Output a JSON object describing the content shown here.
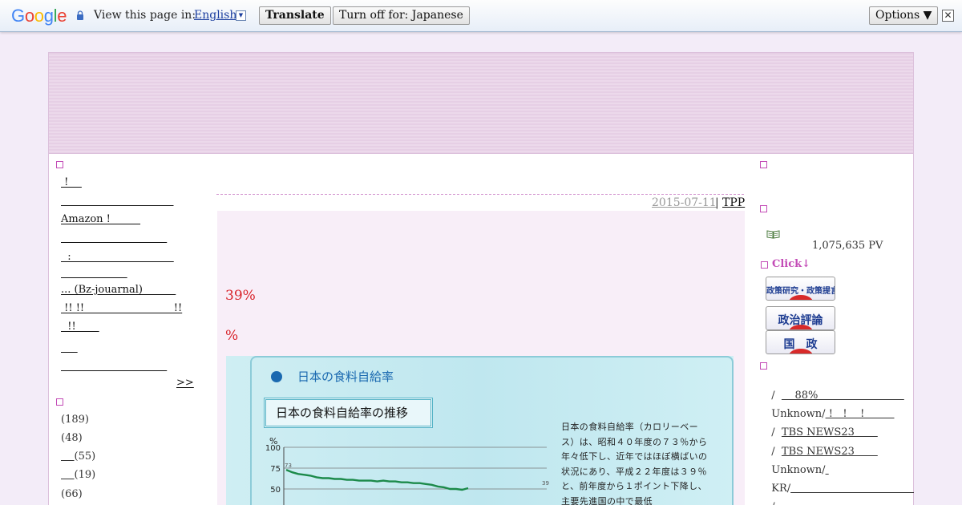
{
  "translate_bar": {
    "logo": "Google",
    "view_prefix": "View this page in:",
    "language": "English",
    "language_arrow": "▼",
    "translate_label": "Translate",
    "turn_off_label": "Turn off for: Japanese",
    "options_label": "Options ▼",
    "close_glyph": "✕"
  },
  "left_sidebar": {
    "links": [
      " !    ",
      "                                  ",
      "Amazon !         ",
      "                                ",
      "  :                               ",
      "                    ",
      "... (Bz-jouarnal)          ",
      " !! !!                           !!",
      "  !!       ",
      "     ",
      "                                "
    ],
    "more_label": ">>",
    "categories": [
      {
        "pre": "",
        "count": "(189)"
      },
      {
        "pre": "",
        "count": "(48)"
      },
      {
        "pre": "    ",
        "count": "(55)"
      },
      {
        "pre": "    ",
        "count": "(19)"
      },
      {
        "pre": "",
        "count": "(66)"
      }
    ]
  },
  "post": {
    "date": "2015-07-11",
    "separator": "|",
    "category": "TPP",
    "red_line_1": "39%",
    "red_line_2": "%",
    "figure": {
      "title": "日本の食料自給率",
      "subtitle": "日本の食料自給率の推移",
      "description": "日本の食料自給率（カロリーベース）は、昭和４０年度の７３％から年々低下し、近年ではほぼ横ばいの状況にあり、平成２２年度は３９％と、前年度から１ポイント下降し、主要先進国の中で最低",
      "y_unit": "%",
      "y_ticks": [
        "100",
        "75",
        "50"
      ],
      "start_label": "73",
      "end_label": "39",
      "chart_data": {
        "type": "line",
        "title": "日本の食料自給率の推移",
        "ylabel": "%",
        "ylim": [
          50,
          100
        ],
        "series": [
          {
            "values": [
              73,
              70,
              68,
              67,
              66,
              64,
              63,
              63,
              62,
              62,
              61,
              61,
              60,
              60,
              60,
              59,
              60,
              59,
              59,
              58,
              58,
              57,
              57,
              56,
              55,
              53,
              52,
              50,
              50,
              49,
              51
            ]
          }
        ]
      }
    }
  },
  "right_sidebar": {
    "pv_icon": "open-book-icon",
    "pv_count": "1,075,635 PV",
    "click_heading": "Click↓",
    "banners": [
      "政策研究・政策提言",
      "政治評論",
      "国　政"
    ],
    "links": [
      {
        "prefix": "/  ",
        "text": "    88%                          "
      },
      {
        "prefix": "Unknown/",
        "text": " !   !    !         "
      },
      {
        "prefix": "/  ",
        "text": "TBS NEWS23       "
      },
      {
        "prefix": "/  ",
        "text": "TBS NEWS23       "
      },
      {
        "prefix": "Unknown/",
        "text": " "
      },
      {
        "prefix": "KR/",
        "text": "                                        "
      },
      {
        "prefix": "/  ",
        "text": "                                             "
      }
    ]
  },
  "colors": {
    "accent": "#c34bb6",
    "red_text": "#d8232a",
    "header_band": "#e6cfe5"
  }
}
